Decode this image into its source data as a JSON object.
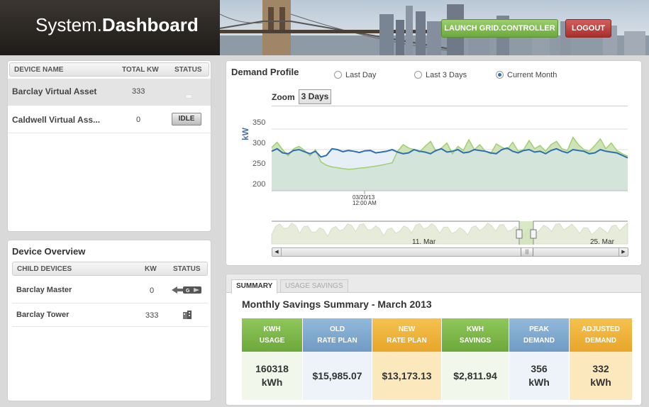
{
  "header": {
    "logo_prefix": "System.",
    "logo_bold": "Dashboard",
    "launch_label": "LAUNCH GRID.CONTROLLER",
    "logout_label": "LOGOUT"
  },
  "devices": {
    "columns": [
      "DEVICE NAME",
      "TOTAL KW",
      "STATUS"
    ],
    "rows": [
      {
        "name": "Barclay Virtual Asset",
        "kw": "333",
        "status": ""
      },
      {
        "name": "Caldwell Virtual Ass...",
        "kw": "0",
        "status": "IDLE"
      }
    ]
  },
  "overview": {
    "title": "Device Overview",
    "columns": [
      "CHILD DEVICES",
      "KW",
      "STATUS"
    ],
    "rows": [
      {
        "name": "Barclay Master",
        "kw": "0",
        "status_icon": "grid-connection-icon"
      },
      {
        "name": "Barclay Tower",
        "kw": "333",
        "status_icon": "building-icon"
      }
    ]
  },
  "demand": {
    "title": "Demand Profile",
    "radios": [
      {
        "label": "Last Day",
        "selected": false
      },
      {
        "label": "Last 3 Days",
        "selected": false
      },
      {
        "label": "Current Month",
        "selected": true
      }
    ],
    "zoom_label": "Zoom",
    "zoom_value": "3 Days",
    "ylabel": "kW",
    "yticks": [
      "350",
      "300",
      "250",
      "200"
    ],
    "marker_label_1": "03/20/13",
    "marker_label_2": "12:00 AM",
    "navigator_labels": [
      "11. Mar",
      "25. Mar"
    ]
  },
  "chart_data": {
    "type": "area",
    "ylabel": "kW",
    "ylim": [
      175,
      375
    ],
    "series": [
      {
        "color": "#2e6fb0",
        "values": [
          296,
          302,
          292,
          290,
          298,
          300,
          295,
          290,
          296,
          282,
          286,
          302,
          300,
          295,
          298,
          296,
          293,
          297,
          298,
          292,
          294,
          296,
          300,
          294,
          290,
          292,
          300,
          296,
          294,
          290,
          298,
          302,
          294,
          296,
          300,
          292,
          294,
          300,
          298,
          296,
          292,
          290,
          300,
          304,
          296,
          292,
          298,
          300,
          294,
          296,
          290,
          298,
          302,
          296,
          292,
          300,
          298,
          296,
          290,
          292,
          300,
          296,
          294,
          292,
          286,
          280
        ]
      },
      {
        "color": "#9fd06f",
        "values": [
          305,
          318,
          300,
          285,
          302,
          308,
          298,
          285,
          300,
          270,
          262,
          258,
          256,
          254,
          252,
          253,
          255,
          256,
          258,
          260,
          262,
          265,
          268,
          296,
          312,
          304,
          300,
          294,
          308,
          320,
          296,
          304,
          316,
          290,
          308,
          298,
          324,
          300,
          312,
          296,
          290,
          314,
          306,
          300,
          318,
          296,
          300,
          322,
          302,
          310,
          296,
          312,
          320,
          302,
          298,
          330,
          312,
          300,
          296,
          310,
          326,
          302,
          316,
          298,
          290,
          284
        ]
      }
    ]
  },
  "summary": {
    "tabs": [
      "SUMMARY",
      "USAGE SAVINGS"
    ],
    "title": "Monthly Savings Summary - March 2013",
    "cards": [
      {
        "h1": "KWH",
        "h2": "USAGE",
        "v1": "160318",
        "v2": "kWh"
      },
      {
        "h1": "OLD",
        "h2": "RATE PLAN",
        "v1": "$15,985.07",
        "v2": ""
      },
      {
        "h1": "NEW",
        "h2": "RATE PLAN",
        "v1": "$13,173.13",
        "v2": ""
      },
      {
        "h1": "KWH",
        "h2": "SAVINGS",
        "v1": "$2,811.94",
        "v2": ""
      },
      {
        "h1": "PEAK",
        "h2": "DEMAND",
        "v1": "356",
        "v2": "kWh"
      },
      {
        "h1": "ADJUSTED",
        "h2": "DEMAND",
        "v1": "332",
        "v2": "kWh"
      }
    ],
    "colors": {
      "green": "#7bb83f",
      "blue": "#7da8cf",
      "orange": "#efb23a"
    }
  }
}
